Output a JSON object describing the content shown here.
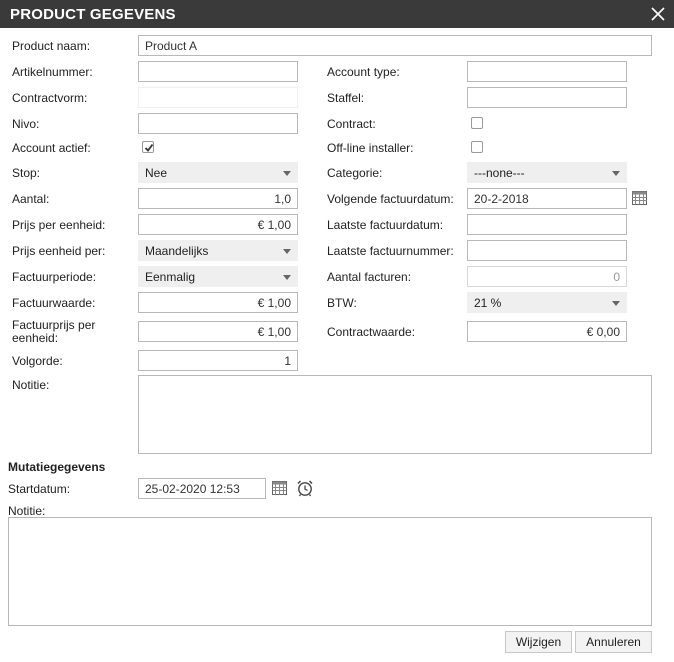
{
  "dialog": {
    "title": "PRODUCT GEGEVENS"
  },
  "left": {
    "product_naam": {
      "label": "Product naam:",
      "value": "Product A"
    },
    "artikelnummer": {
      "label": "Artikelnummer:",
      "value": ""
    },
    "contractvorm": {
      "label": "Contractvorm:",
      "value": ""
    },
    "nivo": {
      "label": "Nivo:",
      "value": ""
    },
    "account_actief": {
      "label": "Account actief:",
      "checked": true
    },
    "stop": {
      "label": "Stop:",
      "value": "Nee"
    },
    "aantal": {
      "label": "Aantal:",
      "value": "1,0"
    },
    "prijs_per_eenheid": {
      "label": "Prijs per eenheid:",
      "value": "€ 1,00"
    },
    "prijs_eenheid_per": {
      "label": "Prijs eenheid per:",
      "value": "Maandelijks"
    },
    "factuurperiode": {
      "label": "Factuurperiode:",
      "value": "Eenmalig"
    },
    "factuurwaarde": {
      "label": "Factuurwaarde:",
      "value": "€ 1,00"
    },
    "factuurprijs_per_eenheid": {
      "label_line1": "Factuurprijs per",
      "label_line2": "eenheid:",
      "value": "€ 1,00"
    },
    "volgorde": {
      "label": "Volgorde:",
      "value": "1"
    },
    "notitie": {
      "label": "Notitie:",
      "value": ""
    }
  },
  "right": {
    "account_type": {
      "label": "Account type:",
      "value": ""
    },
    "staffel": {
      "label": "Staffel:",
      "value": ""
    },
    "contract": {
      "label": "Contract:",
      "checked": false
    },
    "offline_installer": {
      "label": "Off-line installer:",
      "checked": false
    },
    "categorie": {
      "label": "Categorie:",
      "value": "---none---"
    },
    "volgende_factuurdatum": {
      "label": "Volgende factuurdatum:",
      "value": "20-2-2018"
    },
    "laatste_factuurdatum": {
      "label": "Laatste factuurdatum:",
      "value": ""
    },
    "laatste_factuurnummer": {
      "label": "Laatste factuurnummer:",
      "value": ""
    },
    "aantal_facturen": {
      "label": "Aantal facturen:",
      "value": "0"
    },
    "btw": {
      "label": "BTW:",
      "value": "21 %"
    },
    "contractwaarde": {
      "label": "Contractwaarde:",
      "value": "€ 0,00"
    }
  },
  "mutatie": {
    "heading": "Mutatiegegevens",
    "startdatum": {
      "label": "Startdatum:",
      "value": "25-02-2020 12:53"
    },
    "notitie": {
      "label": "Notitie:",
      "value": ""
    }
  },
  "buttons": {
    "wijzigen": "Wijzigen",
    "annuleren": "Annuleren"
  },
  "icons": {
    "close": "close-icon",
    "calendar": "calendar-icon",
    "alarm": "alarm-clock-icon"
  }
}
